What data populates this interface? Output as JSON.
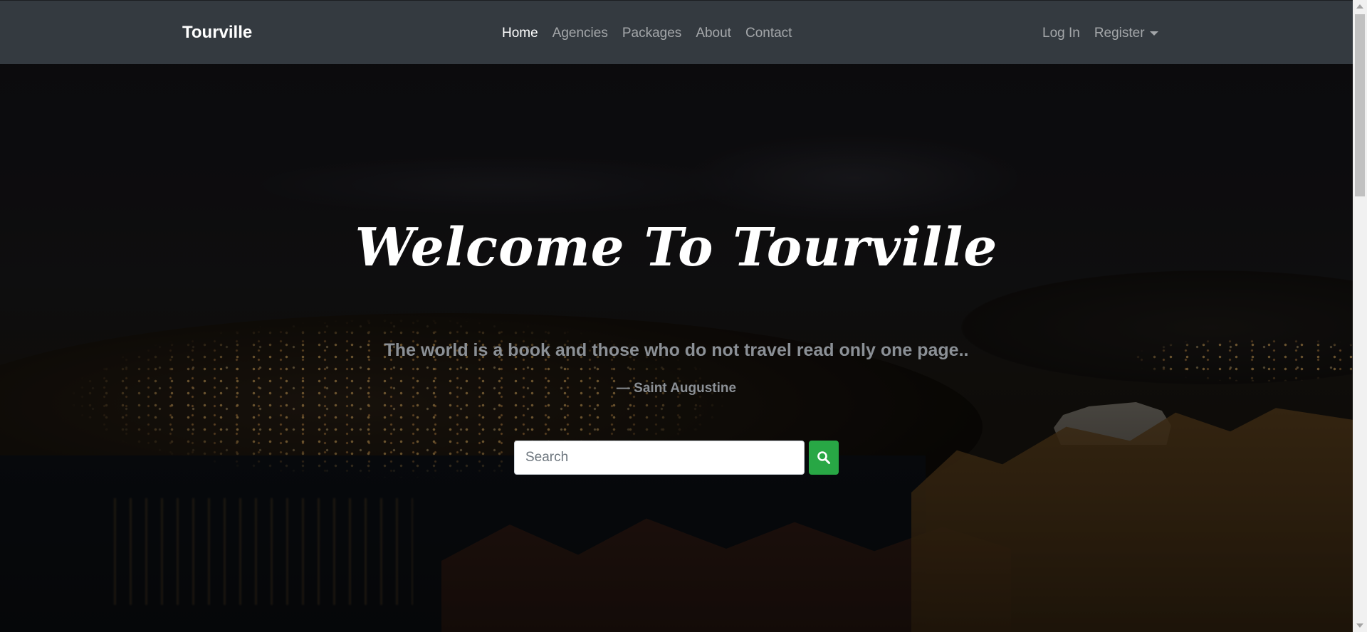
{
  "navbar": {
    "brand": "Tourville",
    "links": [
      {
        "label": "Home",
        "active": true
      },
      {
        "label": "Agencies",
        "active": false
      },
      {
        "label": "Packages",
        "active": false
      },
      {
        "label": "About",
        "active": false
      },
      {
        "label": "Contact",
        "active": false
      }
    ],
    "login_label": "Log In",
    "register_label": "Register"
  },
  "hero": {
    "title": "Welcome To Tourville",
    "quote": "The world is a book and those who do not travel read only one page..",
    "author": "— Saint Augustine"
  },
  "search": {
    "placeholder": "Search",
    "value": "",
    "button_icon": "search-icon"
  },
  "colors": {
    "navbar_bg": "#343a40",
    "search_button": "#28a745"
  }
}
